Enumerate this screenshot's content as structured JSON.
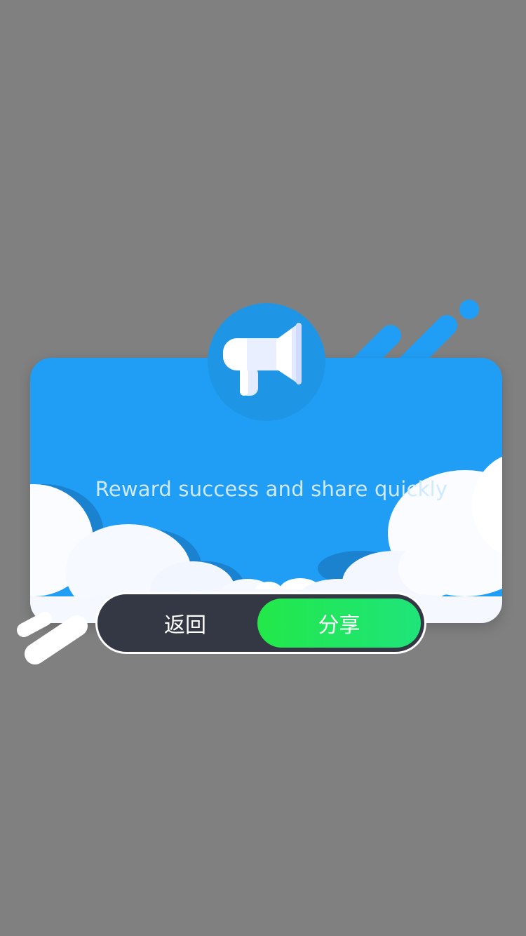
{
  "dialog": {
    "message": "Reward success and share quickly",
    "icon": "megaphone-icon"
  },
  "buttons": {
    "back_label": "返回",
    "share_label": "分享"
  },
  "colors": {
    "backdrop": "#808080",
    "card": "#209ef5",
    "badge": "#1f95e6",
    "button_bar": "#343844",
    "share_button": "#22e84a"
  }
}
